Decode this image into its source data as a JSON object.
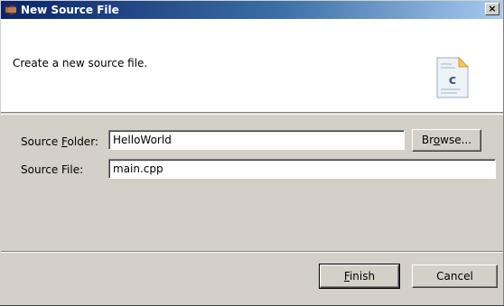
{
  "window": {
    "title": "New Source File",
    "close_glyph": "×"
  },
  "banner": {
    "description": "Create a new source file.",
    "icon_letter": "c",
    "icon": "c-source-file-icon"
  },
  "form": {
    "source_folder": {
      "label_pre": "Source ",
      "label_mnemonic": "F",
      "label_post": "older:",
      "value": "HelloWorld"
    },
    "source_file": {
      "label": "Source File:",
      "value": "main.cpp"
    }
  },
  "buttons": {
    "browse_pre": "Br",
    "browse_mnemonic": "o",
    "browse_post": "wse...",
    "finish_mnemonic": "F",
    "finish_post": "inish",
    "cancel": "Cancel"
  },
  "colors": {
    "titlebar_start": "#0a246a",
    "titlebar_end": "#a6caf0",
    "dialog_bg": "#d4d0c8"
  }
}
